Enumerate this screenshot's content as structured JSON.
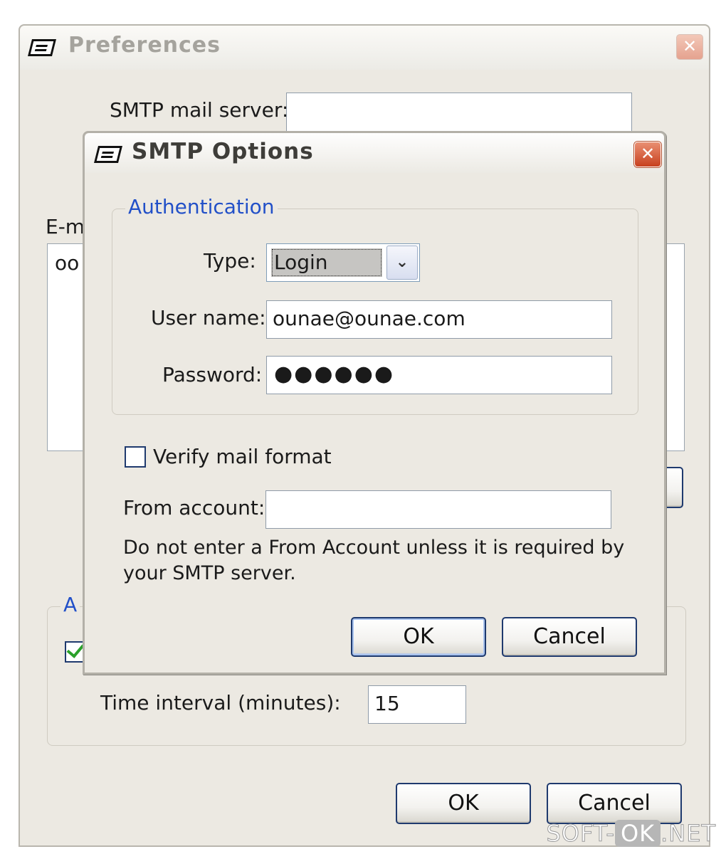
{
  "preferences": {
    "title": "Preferences",
    "smtp_label": "SMTP mail server:",
    "smtp_value": "",
    "email_label_partial": "E-m",
    "list_item_partial": "oo",
    "group_caption_partial": "A",
    "time_interval_label": "Time interval (minutes):",
    "time_interval_value": "15",
    "ok_label": "OK",
    "cancel_label": "Cancel",
    "close_glyph": "✕"
  },
  "smtp_options": {
    "title": "SMTP Options",
    "close_glyph": "✕",
    "authentication": {
      "caption": "Authentication",
      "type_label": "Type:",
      "type_value": "Login",
      "user_label": "User name:",
      "user_value": "ounae@ounae.com",
      "password_label": "Password:",
      "password_value": "●●●●●●"
    },
    "verify_label": "Verify mail format",
    "verify_checked": false,
    "from_label": "From account:",
    "from_value": "",
    "hint_line1": "Do not enter a From Account unless it is required by",
    "hint_line2": "your SMTP server.",
    "ok_label": "OK",
    "cancel_label": "Cancel"
  },
  "watermark": {
    "prefix": "SOFT-",
    "ok": "OK",
    "suffix": ".NET"
  },
  "icons": {
    "app": "app-window-icon",
    "close": "close-icon",
    "dropdown": "chevron-down-icon",
    "check": "checkmark-icon"
  }
}
